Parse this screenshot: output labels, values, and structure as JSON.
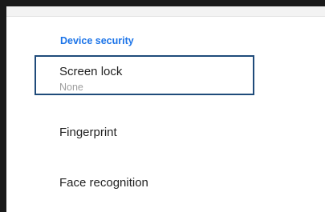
{
  "section": {
    "header": "Device security"
  },
  "items": [
    {
      "title": "Screen lock",
      "summary": "None"
    },
    {
      "title": "Fingerprint"
    },
    {
      "title": "Face recognition"
    }
  ],
  "colors": {
    "accent": "#1a73e8",
    "focus": "#1f4b7a",
    "frame": "#1a1a1a"
  }
}
